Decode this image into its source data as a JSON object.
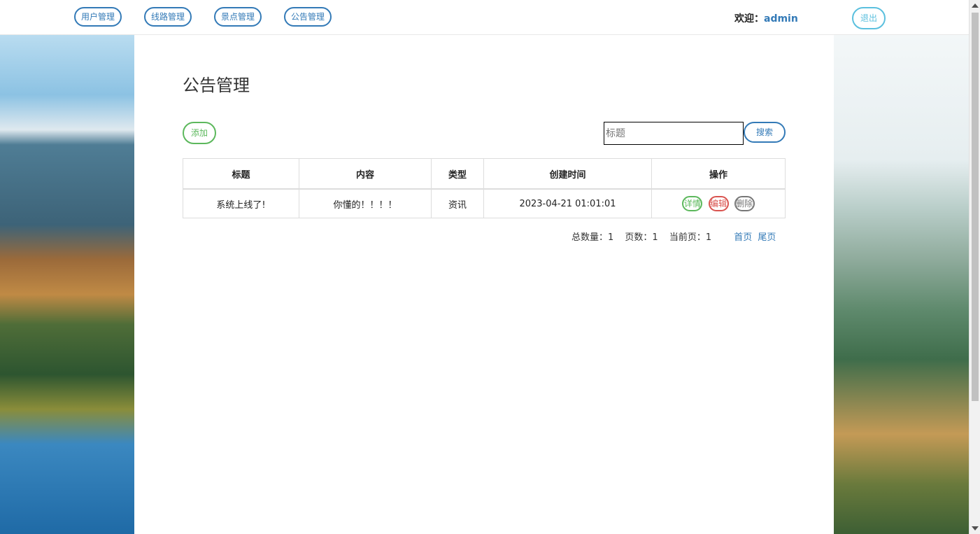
{
  "nav": {
    "items": [
      {
        "label": "用户管理"
      },
      {
        "label": "线路管理"
      },
      {
        "label": "景点管理"
      },
      {
        "label": "公告管理"
      }
    ],
    "welcome_prefix": "欢迎：",
    "username": "admin",
    "logout_label": "退出"
  },
  "page": {
    "title": "公告管理",
    "add_label": "添加",
    "search_placeholder": "标题",
    "search_label": "搜索"
  },
  "table": {
    "headers": [
      "标题",
      "内容",
      "类型",
      "创建时间",
      "操作"
    ],
    "rows": [
      {
        "title": "系统上线了!",
        "content": "你懂的！！！！",
        "type": "资讯",
        "created": "2023-04-21 01:01:01",
        "ops": {
          "detail": "详情",
          "edit": "编辑",
          "delete": "删除"
        }
      }
    ]
  },
  "pager": {
    "total": "总数量：1",
    "pages": "页数：1",
    "current": "当前页：1",
    "first": "首页",
    "last": "尾页"
  },
  "colors": {
    "primary": "#337ab7",
    "success": "#5cb85c",
    "danger": "#d9534f",
    "info": "#5bc0de"
  }
}
